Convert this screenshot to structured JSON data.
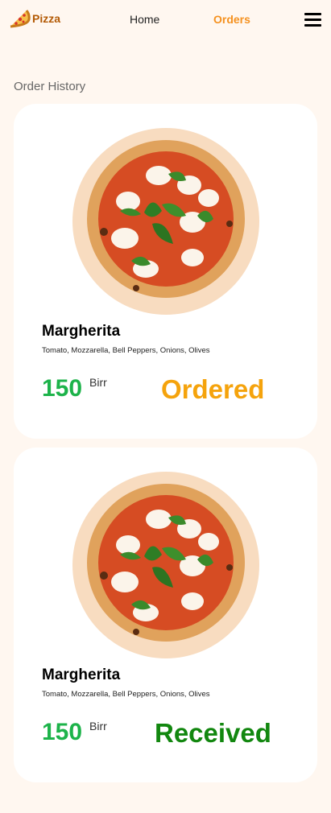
{
  "nav": {
    "logo_text": "Pizza",
    "home_label": "Home",
    "orders_label": "Orders",
    "active_color": "#f5911f"
  },
  "page": {
    "section_title": "Order History"
  },
  "orders": [
    {
      "name": "Margherita",
      "ingredients": "Tomato, Mozzarella, Bell Peppers, Onions, Olives",
      "price": "150",
      "currency": "Birr",
      "status": "Ordered",
      "status_color": "#f5a30c"
    },
    {
      "name": "Margherita",
      "ingredients": "Tomato, Mozzarella, Bell Peppers, Onions, Olives",
      "price": "150",
      "currency": "Birr",
      "status": "Received",
      "status_color": "#12870f"
    }
  ],
  "icons": [
    "pizza-slice-logo-icon",
    "hamburger-menu-icon",
    "pizza-image"
  ]
}
